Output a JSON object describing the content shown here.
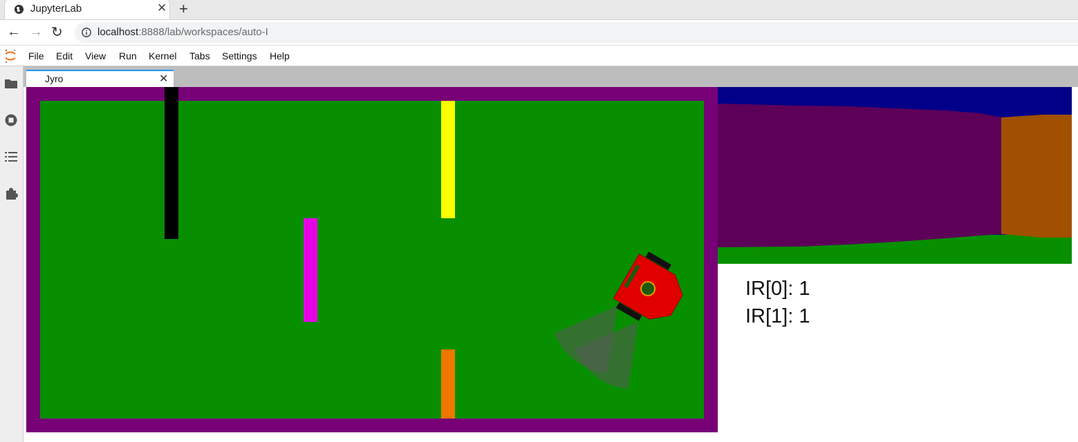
{
  "browser": {
    "tab_title": "JupyterLab",
    "url_host": "localhost",
    "url_rest": ":8888/lab/workspaces/auto-I"
  },
  "menu": [
    "File",
    "Edit",
    "View",
    "Run",
    "Kernel",
    "Tabs",
    "Settings",
    "Help"
  ],
  "sidebar_icons": [
    "folder-icon",
    "running-icon",
    "toc-icon",
    "extension-icon"
  ],
  "dock": {
    "tab_label": "Jyro"
  },
  "simulator": {
    "colors": {
      "wall": "#770077",
      "floor": "#078f00",
      "robot": "#e00000",
      "sky": "#000088",
      "obstacle_black": "#000000",
      "obstacle_yellow": "#ffff00",
      "obstacle_magenta": "#e600e6",
      "obstacle_orange": "#f07800"
    }
  },
  "readouts": {
    "ir0": "IR[0]: 1",
    "ir1": "IR[1]: 1"
  }
}
